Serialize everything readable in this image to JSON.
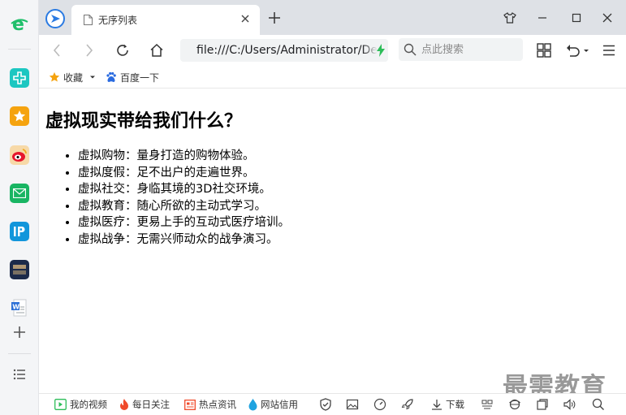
{
  "tab": {
    "title": "无序列表"
  },
  "address_bar": {
    "url": "file:///C:/Users/Administrator/Desktop"
  },
  "search": {
    "placeholder": "点此搜索"
  },
  "bookmarks": {
    "favorites_label": "收藏",
    "baidu_label": "百度一下"
  },
  "page": {
    "heading": "虚拟现实带给我们什么？",
    "items": [
      "虚拟购物：量身打造的购物体验。",
      "虚拟度假：足不出户的走遍世界。",
      "虚拟社交：身临其境的3D社交环境。",
      "虚拟教育：随心所欲的主动式学习。",
      "虚拟医疗：更易上手的互动式医疗培训。",
      "虚拟战争：无需兴师动众的战争演习。"
    ]
  },
  "watermark": "最需教育",
  "status_bar": {
    "my_video": "我的视频",
    "daily_follow": "每日关注",
    "hot_news": "热点资讯",
    "site_credit": "网站信用",
    "download": "下载"
  },
  "sidebar": {
    "icons": [
      "ie-browser-icon",
      "medical-cross-icon",
      "favorites-star-icon",
      "weibo-icon",
      "mail-icon",
      "ip-app-icon",
      "huanqiu-news-icon",
      "word-document-icon",
      "add-icon",
      "menu-list-icon"
    ],
    "colors": {
      "green": "#1fbf6a",
      "teal": "#1cc7c1",
      "gold": "#f5a30f",
      "weibo": "#f0a91f",
      "mail": "#19b563",
      "ip": "#1296db",
      "news": "#1c2a4a"
    }
  },
  "colors": {
    "tabbar": "#dee1e6",
    "accent_blue": "#2a7ae2",
    "bolt_green": "#2dbd59",
    "favorites_star": "#f5a30f"
  }
}
